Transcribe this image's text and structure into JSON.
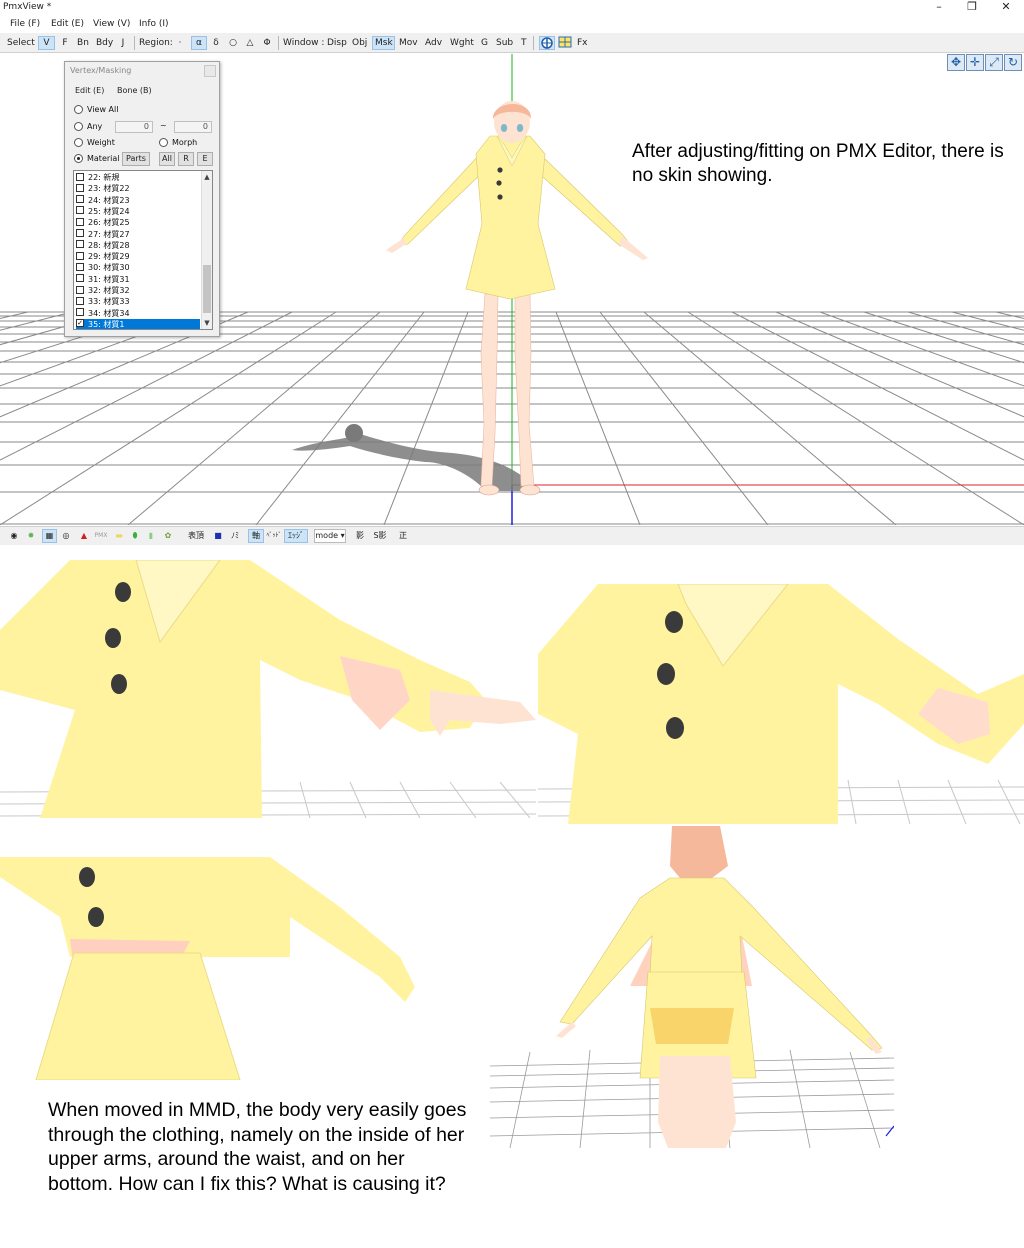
{
  "window": {
    "title": "PmxView *",
    "controls": [
      "–",
      "❐",
      "✕"
    ]
  },
  "menu": [
    "File (F)",
    "Edit (E)",
    "View (V)",
    "Info (I)"
  ],
  "toolbar": {
    "select_label": "Select :",
    "select_items": [
      "V",
      "F",
      "Bn",
      "Bdy",
      "J"
    ],
    "region_label": "Region:",
    "region_items": [
      "·",
      "α",
      "δ",
      "○",
      "△",
      "Φ"
    ],
    "window_label": "Window :",
    "window_items": [
      "Disp",
      "Obj",
      "Msk",
      "Mov",
      "Adv",
      "Wght",
      "G",
      "Sub",
      "T"
    ],
    "fx_label": "Fx"
  },
  "panel": {
    "title": "Vertex/Masking",
    "menu": [
      "Edit (E)",
      "Bone (B)"
    ],
    "view_all": "View All",
    "any": "Any",
    "any_from": "0",
    "tilde": "~",
    "any_to": "0",
    "weight": "Weight",
    "morph": "Morph",
    "material": "Material",
    "parts": "Parts",
    "all": "All",
    "r": "R",
    "e": "E",
    "materials": [
      {
        "label": "22: 新規",
        "checked": false,
        "selected": false
      },
      {
        "label": "23: 材質22",
        "checked": false,
        "selected": false
      },
      {
        "label": "24: 材質23",
        "checked": false,
        "selected": false
      },
      {
        "label": "25: 材質24",
        "checked": false,
        "selected": false
      },
      {
        "label": "26: 材質25",
        "checked": false,
        "selected": false
      },
      {
        "label": "27: 材質27",
        "checked": false,
        "selected": false
      },
      {
        "label": "28: 材質28",
        "checked": false,
        "selected": false
      },
      {
        "label": "29: 材質29",
        "checked": false,
        "selected": false
      },
      {
        "label": "30: 材質30",
        "checked": false,
        "selected": false
      },
      {
        "label": "31: 材質31",
        "checked": false,
        "selected": false
      },
      {
        "label": "32: 材質32",
        "checked": false,
        "selected": false
      },
      {
        "label": "33: 材質33",
        "checked": false,
        "selected": false
      },
      {
        "label": "34: 材質34",
        "checked": false,
        "selected": false
      },
      {
        "label": "35: 材質1",
        "checked": true,
        "selected": true
      }
    ]
  },
  "caption_top": "After adjusting/fitting on PMX Editor, there is no skin showing.",
  "bottom_toolbar": [
    "PMX",
    "表頂",
    "ﾉﾐ",
    "軸",
    "ﾍﾟｯﾄﾞ",
    "ｴｯｼﾞ",
    "mode ▾",
    "影",
    "S影",
    "正"
  ],
  "caption_bottom": "When moved in MMD, the body very easily goes through the clothing, namely on the inside of her upper arms, around the waist, and on her bottom. How can I fix this? What is causing it?",
  "colors": {
    "dress": "#fff3a0",
    "dress_shade": "#f2e47a",
    "skin": "#ffe3d2",
    "skin_shade": "#f8c7b4",
    "hair": "#f6b89a",
    "grid": "#8a8a8a",
    "axis_x": "#e02020",
    "axis_y": "#18b018",
    "axis_z": "#2020e0",
    "selection": "#0078d7"
  }
}
